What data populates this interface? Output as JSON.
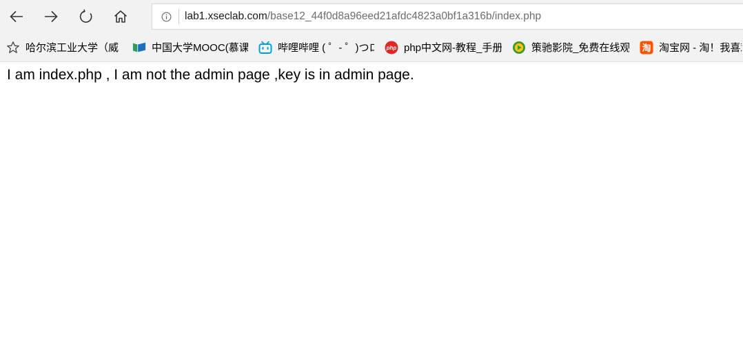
{
  "address": {
    "host": "lab1.xseclab.com",
    "path": "/base12_44f0d8a96eed21afdc4823a0bf1a316b/index.php"
  },
  "favorites": [
    {
      "label": "哈尔滨工业大学（威",
      "icon": "hit-globe-icon"
    },
    {
      "label": "中国大学MOOC(慕课",
      "icon": "mooc-icon"
    },
    {
      "label": "哔哩哔哩 ( ゜- ゜)つロ",
      "icon": "bilibili-icon"
    },
    {
      "label": "php中文网-教程_手册",
      "icon": "php-icon"
    },
    {
      "label": "策驰影院_免费在线观",
      "icon": "cechi-icon"
    },
    {
      "label": "淘宝网 - 淘！我喜欢",
      "icon": "taobao-icon"
    }
  ],
  "page": {
    "text": "I am index.php , I am not the admin page ,key is in admin page."
  }
}
